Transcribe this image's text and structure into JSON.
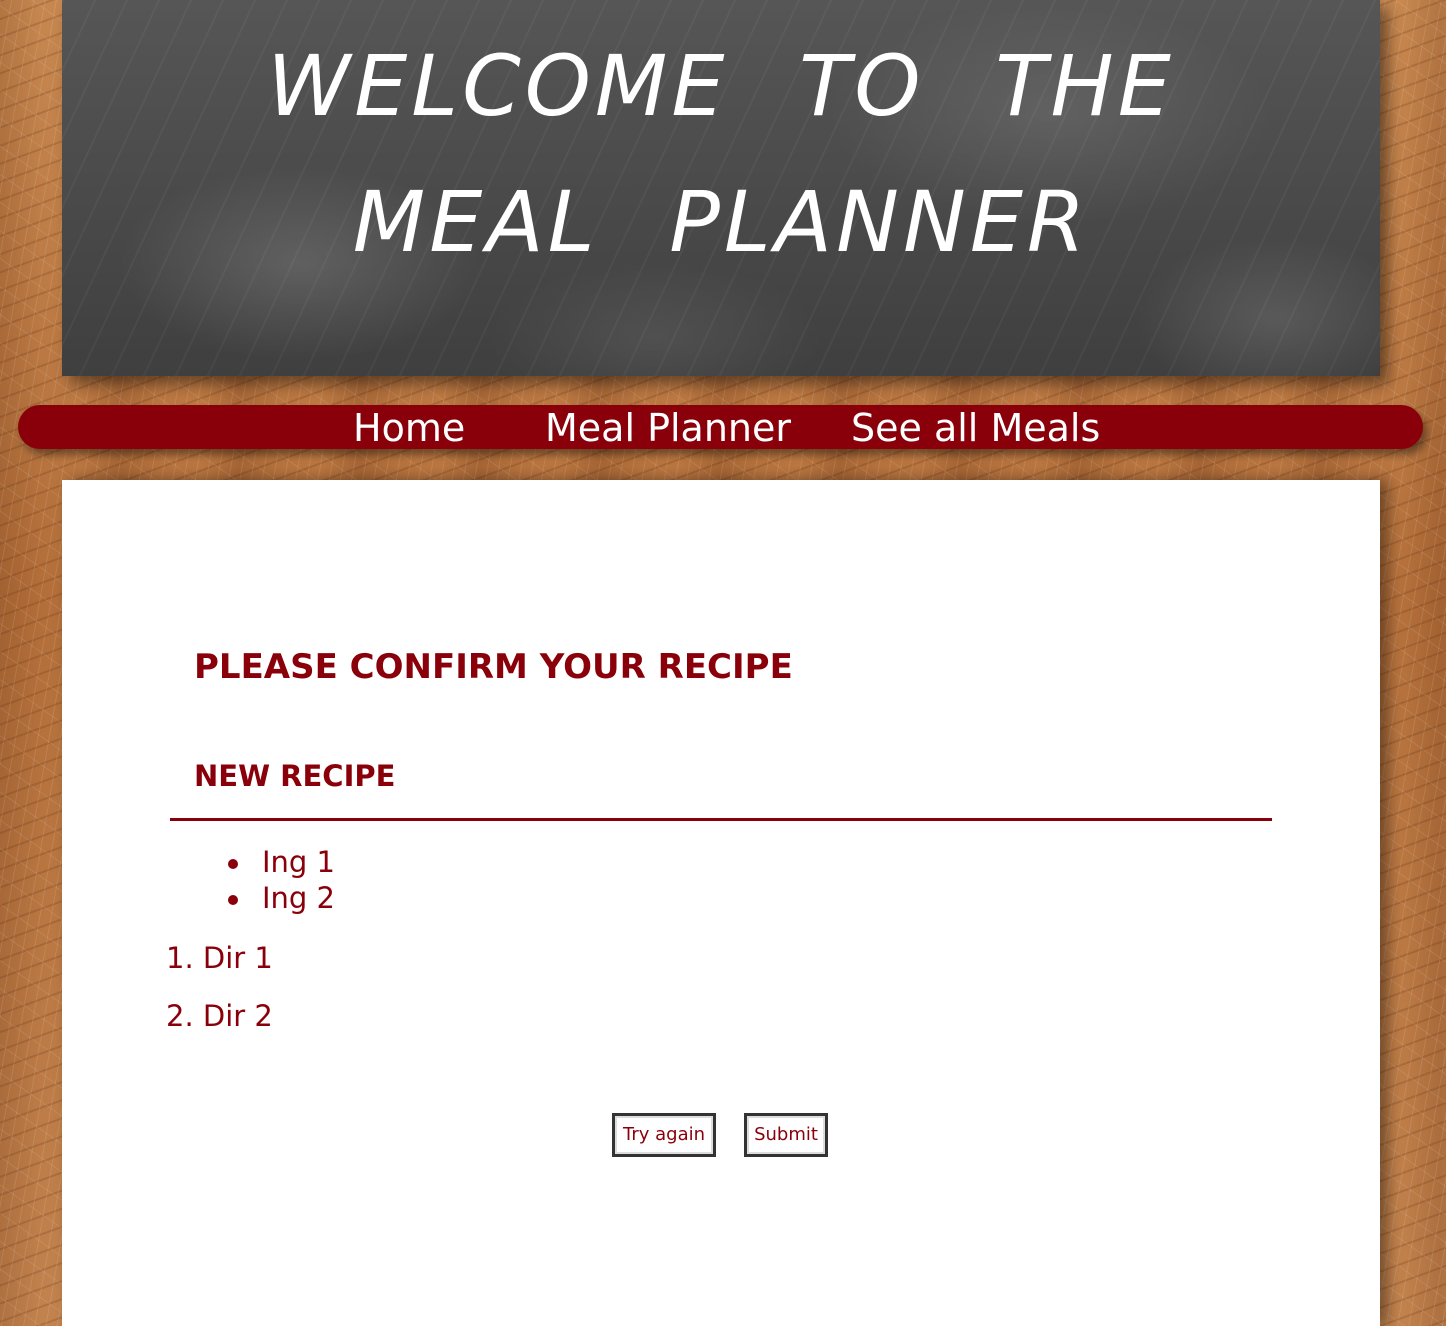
{
  "header": {
    "title": "Welcome to the Meal Planner"
  },
  "nav": {
    "items": [
      {
        "label": "Home"
      },
      {
        "label": "Meal Planner"
      },
      {
        "label": "See all Meals"
      }
    ]
  },
  "main": {
    "page_title": "PLEASE CONFIRM YOUR RECIPE",
    "recipe_name": "NEW RECIPE",
    "ingredients": [
      "Ing 1",
      "Ing 2"
    ],
    "directions": [
      "1. Dir 1",
      "2. Dir 2"
    ],
    "buttons": {
      "try_again": "Try again",
      "submit": "Submit"
    }
  },
  "colors": {
    "accent": "#8a000a",
    "chalkboard": "#4a4a4a",
    "panel": "#ffffff"
  }
}
